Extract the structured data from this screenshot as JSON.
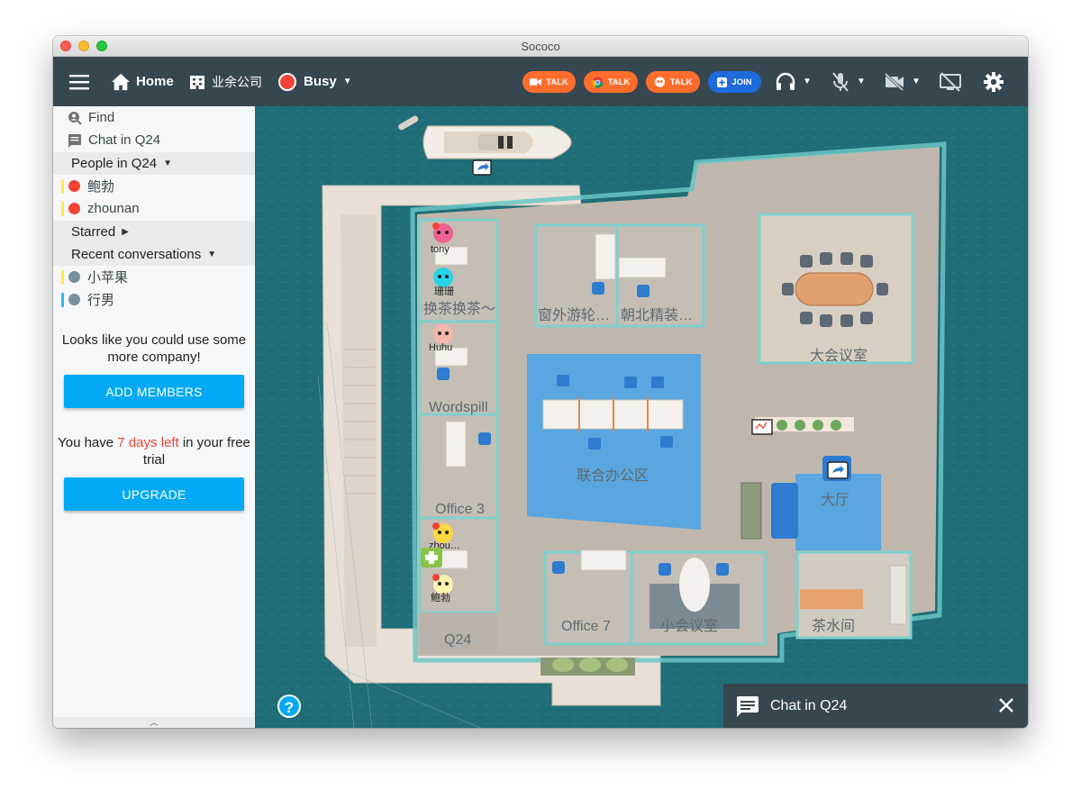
{
  "window": {
    "title": "Sococo"
  },
  "toolbar": {
    "home_label": "Home",
    "company_label": "业余公司",
    "status_label": "Busy",
    "status_color": "#f44336",
    "talk_buttons": [
      {
        "label": "TALK",
        "icon": "video-camera-icon",
        "color": "#ff6d2d"
      },
      {
        "label": "TALK",
        "icon": "chrome-icon",
        "color": "#ff6d2d"
      },
      {
        "label": "TALK",
        "icon": "hangouts-icon",
        "color": "#ff6d2d"
      }
    ],
    "join_button": {
      "label": "JOIN",
      "icon": "plus-box-icon",
      "color": "#1e6bdb"
    },
    "controls": [
      "headset-icon",
      "mic-off-icon",
      "camera-off-icon",
      "screen-share-off-icon",
      "gear-icon"
    ]
  },
  "sidebar": {
    "find_label": "Find",
    "chat_label": "Chat in Q24",
    "people_header": "People in Q24",
    "people": [
      {
        "name": "鲍勃",
        "status_color": "#f44336",
        "bar_color": "#ffeb3b"
      },
      {
        "name": "zhounan",
        "status_color": "#f44336",
        "bar_color": "#ffeb3b"
      }
    ],
    "starred_header": "Starred",
    "recent_header": "Recent conversations",
    "recent": [
      {
        "name": "小苹果",
        "status_color": "#78909c",
        "bar_color": "#ffeb3b"
      },
      {
        "name": "行男",
        "status_color": "#78909c",
        "bar_color": "#29b6f6"
      }
    ],
    "company_msg": "Looks like you could use some more company!",
    "add_members_label": "ADD MEMBERS",
    "trial_prefix": "You have ",
    "trial_days": "7 days left",
    "trial_suffix": " in your free trial",
    "trial_days_color": "#f44336",
    "upgrade_label": "UPGRADE"
  },
  "map": {
    "rooms": [
      "换茶换茶～",
      "窗外游轮…",
      "朝北精装…",
      "大会议室",
      "Wordspill",
      "联合办公区",
      "大厅",
      "Office 3",
      "Office 7",
      "小会议室",
      "茶水间",
      "Q24"
    ],
    "avatars": [
      "tony",
      "珊珊",
      "Huhu",
      "zhou…",
      "鲍勃"
    ]
  },
  "chat_panel": {
    "label": "Chat in Q24"
  },
  "help_label": "?"
}
